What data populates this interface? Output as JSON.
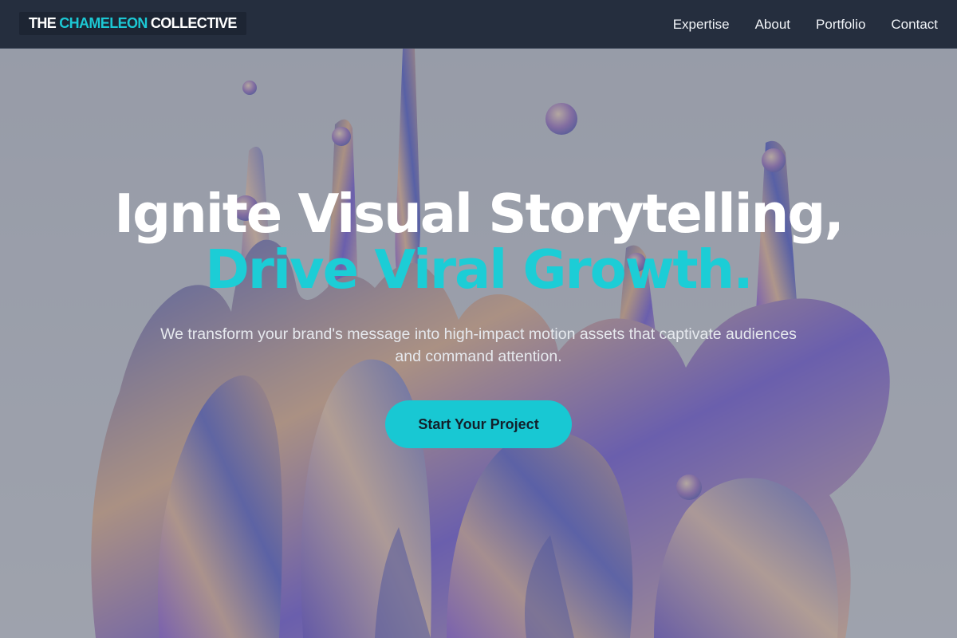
{
  "brand": {
    "logo_part1": "THE",
    "logo_part2": "CHAMELEON",
    "logo_part3": "COLLECTIVE",
    "accent_color": "#1cc8d4"
  },
  "nav": {
    "items": [
      {
        "label": "Expertise"
      },
      {
        "label": "About"
      },
      {
        "label": "Portfolio"
      },
      {
        "label": "Contact"
      }
    ]
  },
  "hero": {
    "headline_line1": "Ignite Visual Storytelling,",
    "headline_line2": "Drive Viral Growth.",
    "subtext": "We transform your brand's message into high-impact motion assets that captivate audiences and command attention.",
    "cta_label": "Start Your Project"
  },
  "colors": {
    "header_bg": "#252e3e",
    "accent": "#1ccdd6",
    "cta_text": "#13202b"
  }
}
